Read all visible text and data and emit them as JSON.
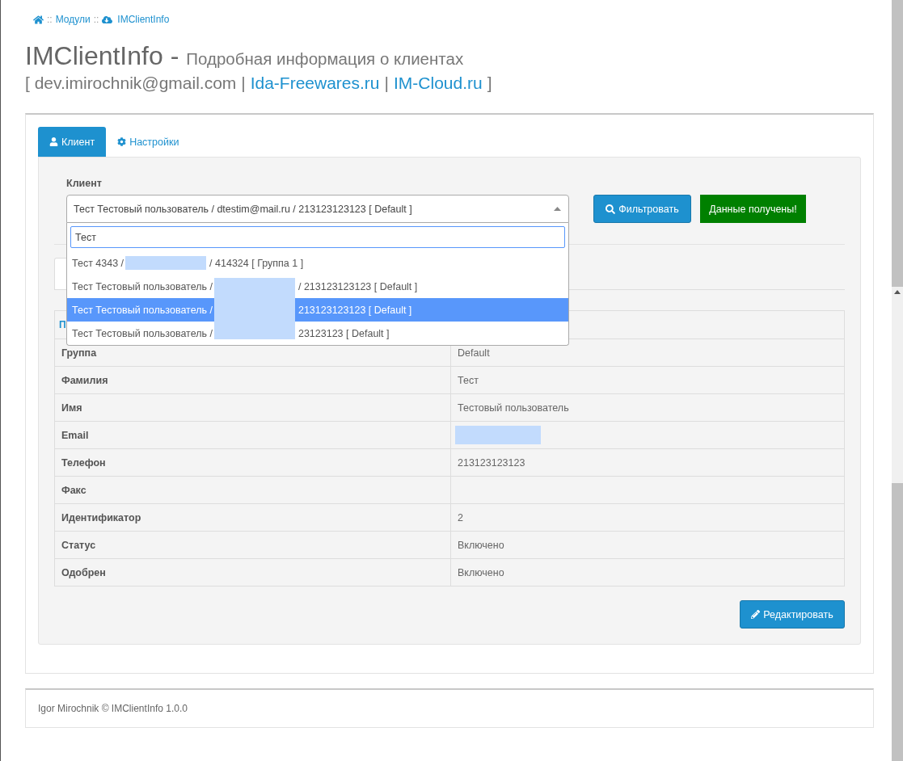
{
  "breadcrumb": [
    {
      "kind": "home"
    },
    {
      "kind": "separator",
      "text": "::"
    },
    {
      "kind": "link",
      "text": "Модули"
    },
    {
      "kind": "separator",
      "text": "::"
    },
    {
      "kind": "module",
      "text": "IMClientInfo"
    }
  ],
  "header": {
    "title": "IMClientInfo -",
    "subtitle": "Подробная информация о клиентах",
    "contacts": [
      {
        "kind": "text",
        "text": "[ dev.imirochnik@gmail.com |"
      },
      {
        "kind": "link",
        "text": "Ida-Freewares.ru"
      },
      {
        "kind": "text",
        "text": "|"
      },
      {
        "kind": "link",
        "text": "IM-Cloud.ru"
      },
      {
        "kind": "text",
        "text": "]"
      }
    ]
  },
  "tabs": [
    {
      "label": "Клиент",
      "selected": true
    },
    {
      "label": "Настройки",
      "selected": false
    }
  ],
  "client_filter": {
    "label": "Клиент",
    "value": "Тест Тестовый пользователь / dtestim@mail.ru / 213123123123 [ Default ]",
    "expanded": true,
    "search": {
      "value": "Тест"
    },
    "options": [
      {
        "before": "Тест 4343 /",
        "after": "/ 414324 [ Группа 1 ]",
        "selected": false
      },
      {
        "before": "Тест Тестовый пользователь /",
        "after": "/ 213123123123 [ Default ]",
        "selected": false
      },
      {
        "before": "Тест Тестовый пользователь /",
        "after": "213123123123 [ Default ]",
        "selected": true
      },
      {
        "before": "Тест Тестовый пользователь /",
        "after": "23123123 [ Default ]",
        "selected": false
      }
    ]
  },
  "filter_button": "Фильтровать",
  "status": {
    "kind": "success",
    "text": "Данные получены!"
  },
  "details": {
    "heading": "П",
    "rows": [
      {
        "label": "Группа",
        "kind": "text",
        "value": "Default"
      },
      {
        "label": "Фамилия",
        "kind": "text",
        "value": "Тест"
      },
      {
        "label": "Имя",
        "kind": "text",
        "value": "Тестовый пользователь"
      },
      {
        "label": "Email",
        "kind": "redacted"
      },
      {
        "label": "Телефон",
        "kind": "text",
        "value": "213123123123"
      },
      {
        "label": "Факс",
        "kind": "text"
      },
      {
        "label": "Идентификатор",
        "kind": "text",
        "value": "2"
      },
      {
        "label": "Статус",
        "kind": "text",
        "value": "Включено"
      },
      {
        "label": "Одобрен",
        "kind": "text",
        "value": "Включено"
      }
    ]
  },
  "edit_button": "Редактировать",
  "footer": "Igor Mirochnik © IMClientInfo 1.0.0"
}
